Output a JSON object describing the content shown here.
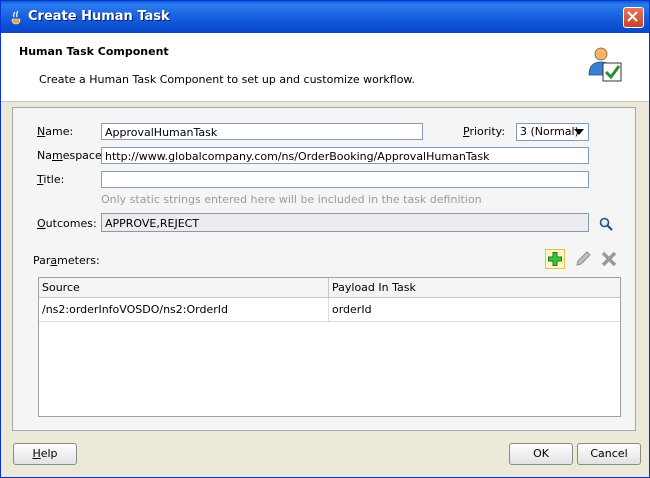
{
  "window": {
    "title": "Create Human Task"
  },
  "header": {
    "title": "Human Task Component",
    "description": "Create a Human Task Component to set up and customize workflow."
  },
  "form": {
    "name": {
      "label_key": "N",
      "label_rest": "ame:",
      "value": "ApprovalHumanTask"
    },
    "priority": {
      "label_key": "P",
      "label_rest": "riority:",
      "value": "3 (Normal)"
    },
    "namespace": {
      "label_pre": "Na",
      "label_key": "m",
      "label_rest": "espace:",
      "value": "http://www.globalcompany.com/ns/OrderBooking/ApprovalHumanTask"
    },
    "title": {
      "label_key": "T",
      "label_rest": "itle:",
      "value": "",
      "hint": "Only static strings entered here will be included in the task definition"
    },
    "outcomes": {
      "label_key": "O",
      "label_rest": "utcomes:",
      "value": "APPROVE,REJECT"
    }
  },
  "parameters": {
    "label_pre": "Par",
    "label_key": "a",
    "label_rest": "meters:",
    "columns": [
      "Source",
      "Payload In Task"
    ],
    "rows": [
      {
        "source": "/ns2:orderInfoVOSDO/ns2:OrderId",
        "payload": "orderId"
      }
    ]
  },
  "footer": {
    "help_key": "H",
    "help_rest": "elp",
    "ok": "OK",
    "cancel": "Cancel"
  },
  "icons": {
    "title": "jdev-icon",
    "header": "human-task-icon",
    "outcomes_search": "search-icon",
    "add": "add-icon",
    "edit": "edit-icon",
    "delete": "delete-icon",
    "close": "close-icon"
  },
  "colors": {
    "titlebar": "#0a5fd8",
    "add_green": "#2fa52f"
  }
}
